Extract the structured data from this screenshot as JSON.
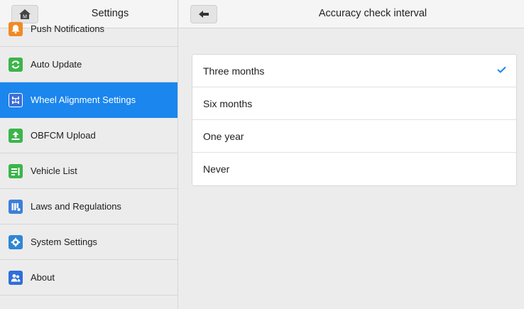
{
  "left_panel": {
    "title": "Settings",
    "home_icon_label": "M",
    "items": [
      {
        "label": "Push Notifications",
        "icon": "bell-icon",
        "color": "#f08a24",
        "active": false
      },
      {
        "label": "Auto Update",
        "icon": "refresh-icon",
        "color": "#3bb54a",
        "active": false
      },
      {
        "label": "Wheel Alignment Settings",
        "icon": "alignment-icon",
        "color": "#3d6fd8",
        "active": true
      },
      {
        "label": "OBFCM Upload",
        "icon": "upload-icon",
        "color": "#3bb54a",
        "active": false
      },
      {
        "label": "Vehicle List",
        "icon": "vehicle-list-icon",
        "color": "#3bb54a",
        "active": false
      },
      {
        "label": "Laws and Regulations",
        "icon": "books-icon",
        "color": "#3d7fd8",
        "active": false
      },
      {
        "label": "System Settings",
        "icon": "gear-icon",
        "color": "#2f86d6",
        "active": false
      },
      {
        "label": "About",
        "icon": "people-icon",
        "color": "#2f6fd8",
        "active": false
      }
    ]
  },
  "right_panel": {
    "title": "Accuracy check interval",
    "options": [
      {
        "label": "Three months",
        "selected": true
      },
      {
        "label": "Six months",
        "selected": false
      },
      {
        "label": "One year",
        "selected": false
      },
      {
        "label": "Never",
        "selected": false
      }
    ]
  },
  "colors": {
    "accent": "#1a86ee",
    "check": "#1a86ee"
  }
}
